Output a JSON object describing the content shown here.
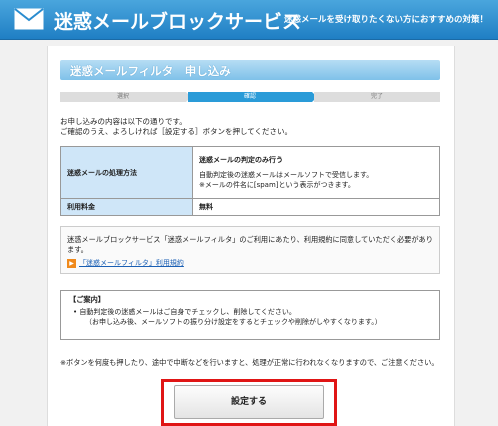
{
  "header": {
    "brand": "迷惑メールブロックサービス",
    "tagline": "迷惑メールを受け取りたくない方におすすめの対策！"
  },
  "section_title": "迷惑メールフィルタ　申し込み",
  "steps": [
    {
      "label": "選択"
    },
    {
      "label": "確認"
    },
    {
      "label": "完了"
    }
  ],
  "intro": {
    "line1": "お申し込みの内容は以下の通りです。",
    "line2": "ご確認のうえ、よろしければ［設定する］ボタンを押してください。"
  },
  "info_table": {
    "method_label": "迷惑メールの処理方法",
    "method_title": "迷惑メールの判定のみ行う",
    "method_desc1": "自動判定後の迷惑メールはメールソフトで受信します。",
    "method_desc2": "※メールの件名に[spam]という表示がつきます。",
    "fee_label": "利用料金",
    "fee_value": "無料"
  },
  "terms": {
    "text": "迷惑メールブロックサービス「迷惑メールフィルタ」のご利用にあたり、利用規約に同意していただく必要があります。",
    "link": "「迷惑メールフィルタ」利用規約"
  },
  "notice": {
    "title": "【ご案内】",
    "line1": "•  自動判定後の迷惑メールはご自身でチェックし、削除してください。",
    "line2": "（お申し込み後、メールソフトの振り分け設定をするとチェックや削除がしやすくなります。）"
  },
  "warning": "※ボタンを何度も押したり、途中で中断などを行いますと、処理が正常に行われなくなりますので、ご注意ください。",
  "submit_label": "設定する"
}
